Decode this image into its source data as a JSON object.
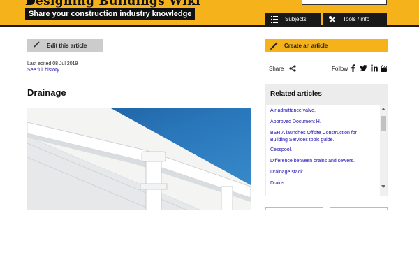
{
  "header": {
    "site_title": "Designing Buildings Wiki",
    "tagline": "Share your construction industry knowledge",
    "nav": [
      {
        "label": "Subjects",
        "icon": "list-icon"
      },
      {
        "label": "Tools / info",
        "icon": "tools-icon"
      }
    ]
  },
  "toolbar": {
    "edit_label": "Edit this article",
    "create_label": "Create an article"
  },
  "meta": {
    "last_edited": "Last edited 08 Jul 2019",
    "history_link": "See full history"
  },
  "article": {
    "title": "Drainage"
  },
  "social": {
    "share_label": "Share",
    "follow_label": "Follow",
    "follow_icons": [
      "facebook-icon",
      "twitter-icon",
      "linkedin-icon",
      "youtube-icon"
    ]
  },
  "related": {
    "title": "Related articles",
    "items": [
      "Air admittance valve.",
      "Approved Document H.",
      "BSRIA launches Offsite Construction for Building Services topic guide.",
      "Cesspool.",
      "Difference between drains and sewers.",
      "Drainage stack.",
      "Drains."
    ]
  },
  "colors": {
    "brand_yellow": "#f5b21a",
    "dark": "#1a1a1a",
    "link": "#1a0dab",
    "grey_button": "#cccccc"
  }
}
